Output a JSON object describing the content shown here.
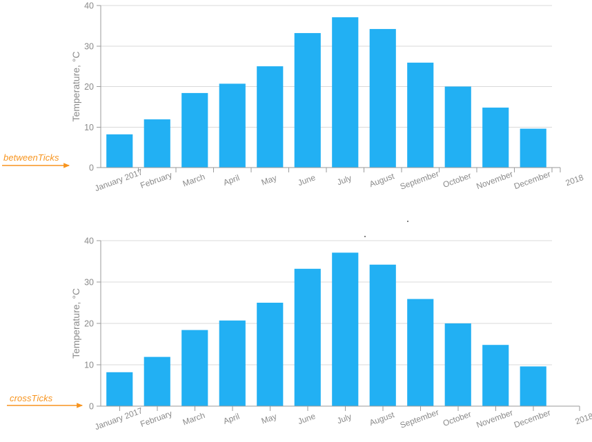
{
  "chart_data": [
    {
      "id": "betweenTicks",
      "type": "bar",
      "title": "",
      "xlabel": "",
      "ylabel": "Temperature, °C",
      "categories": [
        "January 2017",
        "February",
        "March",
        "April",
        "May",
        "June",
        "July",
        "August",
        "September",
        "October",
        "November",
        "December"
      ],
      "values": [
        8.2,
        11.9,
        18.4,
        20.7,
        25.0,
        33.2,
        37.1,
        34.2,
        25.9,
        20.0,
        14.8,
        9.6
      ],
      "end_tick_label": "2018",
      "ylim": [
        0,
        40
      ],
      "yticks": [
        0,
        10,
        20,
        30,
        40
      ],
      "ytick_labels": [
        "0",
        "10",
        "20",
        "30",
        "40"
      ],
      "grid": true,
      "legend": null,
      "tick_mode": "betweenTicks",
      "bar_color": "#22B0F3",
      "annotation": "betweenTicks"
    },
    {
      "id": "crossTicks",
      "type": "bar",
      "title": "",
      "xlabel": "",
      "ylabel": "Temperature, °C",
      "categories": [
        "January 2017",
        "February",
        "March",
        "April",
        "May",
        "June",
        "July",
        "August",
        "September",
        "October",
        "November",
        "December"
      ],
      "values": [
        8.2,
        11.9,
        18.4,
        20.7,
        25.0,
        33.2,
        37.1,
        34.2,
        25.9,
        20.0,
        14.8,
        9.6
      ],
      "end_tick_label": "2018",
      "ylim": [
        0,
        40
      ],
      "yticks": [
        0,
        10,
        20,
        30,
        40
      ],
      "ytick_labels": [
        "0",
        "10",
        "20",
        "30",
        "40"
      ],
      "grid": true,
      "legend": null,
      "tick_mode": "crossTicks",
      "bar_color": "#22B0F3",
      "annotation": "crossTicks"
    }
  ],
  "annotations": {
    "between_ticks_label": "betweenTicks",
    "cross_ticks_label": "crossTicks",
    "arrow_color": "#F7941E"
  },
  "colors": {
    "bar": "#22B0F3",
    "grid": "#D9D9D9",
    "axis": "#9A9A9A",
    "tick_text": "#8A8A8A",
    "axis_title": "#8A8A8A",
    "accent": "#F7941E"
  }
}
